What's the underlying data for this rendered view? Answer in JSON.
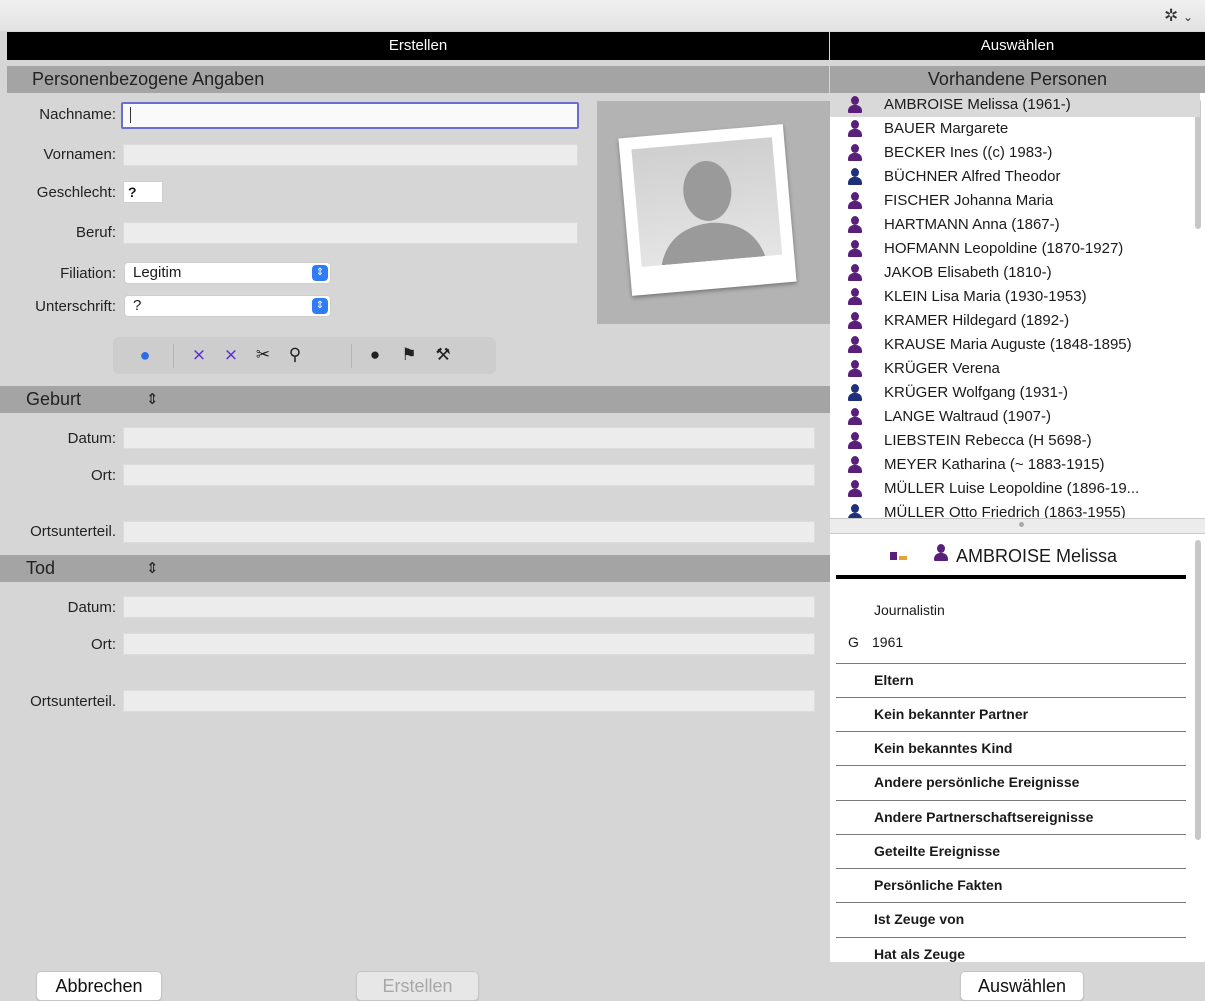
{
  "left_panel": {
    "header": "Erstellen",
    "personal": {
      "title": "Personenbezogene Angaben",
      "labels": {
        "nachname": "Nachname:",
        "vornamen": "Vornamen:",
        "geschlecht": "Geschlecht:",
        "beruf": "Beruf:",
        "filiation": "Filiation:",
        "unterschrift": "Unterschrift:"
      },
      "values": {
        "geschlecht": "?",
        "filiation": "Legitim",
        "unterschrift": "?"
      }
    },
    "birth": {
      "title": "Geburt",
      "labels": {
        "datum": "Datum:",
        "ort": "Ort:",
        "ortsunterteil": "Ortsunterteil."
      }
    },
    "death": {
      "title": "Tod",
      "labels": {
        "datum": "Datum:",
        "ort": "Ort:",
        "ortsunterteil": "Ortsunterteil."
      }
    }
  },
  "right_panel": {
    "header": "Auswählen",
    "list_title": "Vorhandene Personen",
    "persons": [
      {
        "name": "AMBROISE Melissa (1961-)",
        "sex": "f"
      },
      {
        "name": "BAUER Margarete",
        "sex": "f"
      },
      {
        "name": "BECKER Ines ((c) 1983-)",
        "sex": "f"
      },
      {
        "name": "BÜCHNER Alfred Theodor",
        "sex": "m"
      },
      {
        "name": "FISCHER Johanna Maria",
        "sex": "f"
      },
      {
        "name": "HARTMANN Anna (1867-)",
        "sex": "f"
      },
      {
        "name": "HOFMANN Leopoldine (1870-1927)",
        "sex": "f"
      },
      {
        "name": "JAKOB Elisabeth (1810-)",
        "sex": "f"
      },
      {
        "name": "KLEIN Lisa Maria (1930-1953)",
        "sex": "f"
      },
      {
        "name": "KRAMER Hildegard (1892-)",
        "sex": "f"
      },
      {
        "name": "KRAUSE Maria Auguste (1848-1895)",
        "sex": "f"
      },
      {
        "name": "KRÜGER Verena",
        "sex": "f"
      },
      {
        "name": "KRÜGER Wolfgang (1931-)",
        "sex": "m"
      },
      {
        "name": "LANGE Waltraud (1907-)",
        "sex": "f"
      },
      {
        "name": "LIEBSTEIN Rebecca (H 5698-)",
        "sex": "f"
      },
      {
        "name": "MEYER Katharina (~ 1883-1915)",
        "sex": "f"
      },
      {
        "name": "MÜLLER Luise Leopoldine (1896-19...",
        "sex": "f"
      },
      {
        "name": "MÜLLER Otto Friedrich (1863-1955)",
        "sex": "m"
      }
    ],
    "detail": {
      "name": "AMBROISE Melissa",
      "occupation": "Journalistin",
      "birth_marker": "G",
      "birth_year": "1961",
      "sections": [
        "Eltern",
        "Kein bekannter Partner",
        "Kein bekanntes Kind",
        "Andere persönliche Ereignisse",
        "Andere Partnerschaftsereignisse",
        "Geteilte Ereignisse",
        "Persönliche Fakten",
        "Ist Zeuge von",
        "Hat als Zeuge"
      ]
    }
  },
  "buttons": {
    "cancel": "Abbrechen",
    "create": "Erstellen",
    "select": "Auswählen"
  },
  "icons": {
    "settings": "gear-icon",
    "chevron": "chevron-down-icon"
  },
  "colors": {
    "female": "#5a1f7a",
    "male": "#1f2f7a",
    "focus": "#6c6fc9",
    "accent": "#2f7cf6"
  }
}
